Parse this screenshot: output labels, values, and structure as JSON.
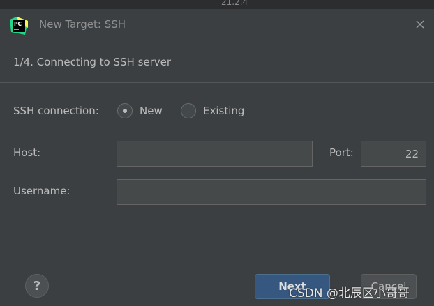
{
  "top_strip_text": "21.2.4",
  "window": {
    "title": "New Target: SSH"
  },
  "step": {
    "title": "1/4. Connecting to SSH server"
  },
  "ssh_connection": {
    "label": "SSH connection:",
    "options": [
      {
        "label": "New",
        "selected": true
      },
      {
        "label": "Existing",
        "selected": false
      }
    ]
  },
  "host": {
    "label": "Host:",
    "value": ""
  },
  "port": {
    "label": "Port:",
    "value": "22"
  },
  "username": {
    "label": "Username:",
    "value": ""
  },
  "footer": {
    "help_label": "?",
    "next_label": "Next",
    "cancel_label": "Cancel"
  },
  "watermark": "CSDN @北辰区小哥哥",
  "icons": {
    "app_logo": "pycharm-logo-icon",
    "close": "close-icon"
  },
  "colors": {
    "background": "#3c3f41",
    "primary_button": "#365880",
    "text": "#bbbbbb"
  }
}
